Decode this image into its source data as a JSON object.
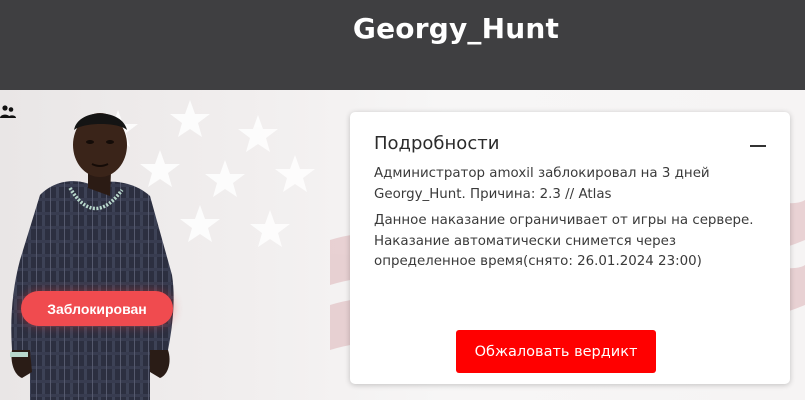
{
  "header": {
    "player_name": "Georgy_Hunt"
  },
  "profile": {
    "status_badge": "Заблокирован",
    "group_icon": "users-icon",
    "background": "us-flag"
  },
  "details": {
    "title": "Подробности",
    "collapse_icon": "minus-icon",
    "ban_message": "Администратор amoxil заблокировал на 3 дней Georgy_Hunt. Причина: 2.3 // Atlas",
    "notice": "Данное наказание ограничивает от игры на сервере. Наказание автоматически снимется через определенное время(снято: 26.01.2024 23:00)",
    "appeal_button": "Обжаловать вердикт"
  },
  "colors": {
    "header_bg": "#3f3f41",
    "badge_bg": "#f04b4f",
    "button_bg": "#ff0000"
  }
}
